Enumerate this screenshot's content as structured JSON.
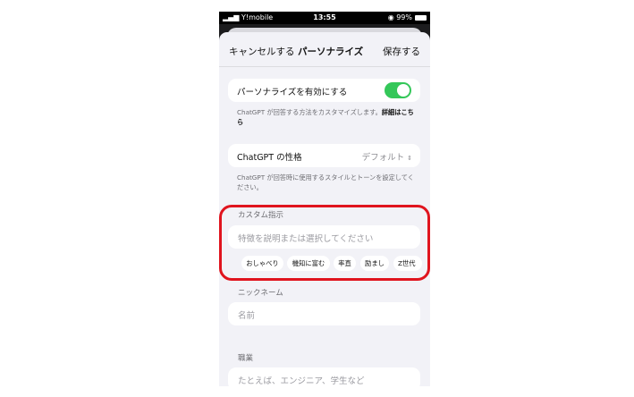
{
  "status_bar": {
    "carrier": "Y!mobile",
    "time": "13:55",
    "battery": "99%"
  },
  "nav": {
    "cancel_label": "キャンセルする",
    "title": "パーソナライズ",
    "save_label": "保存する"
  },
  "personalize": {
    "toggle_label": "パーソナライズを有効にする",
    "toggle_on": true,
    "caption_text": "ChatGPT が回答する方法をカスタマイズします。",
    "caption_link": "詳細はこちら"
  },
  "personality": {
    "label": "ChatGPT の性格",
    "value": "デフォルト",
    "caption": "ChatGPT が回答時に使用するスタイルとトーンを設定してください。"
  },
  "custom_instructions": {
    "title": "カスタム指示",
    "placeholder": "特徴を説明または選択してください",
    "chips": [
      "おしゃべり",
      "機知に富む",
      "率直",
      "励まし",
      "Z世代"
    ]
  },
  "nickname": {
    "title": "ニックネーム",
    "placeholder": "名前"
  },
  "occupation": {
    "title": "職業",
    "placeholder": "たとえば、エンジニア、学生など"
  },
  "colors": {
    "toggle_on": "#34c759",
    "highlight": "#e0141e",
    "background": "#f2f2f7"
  }
}
